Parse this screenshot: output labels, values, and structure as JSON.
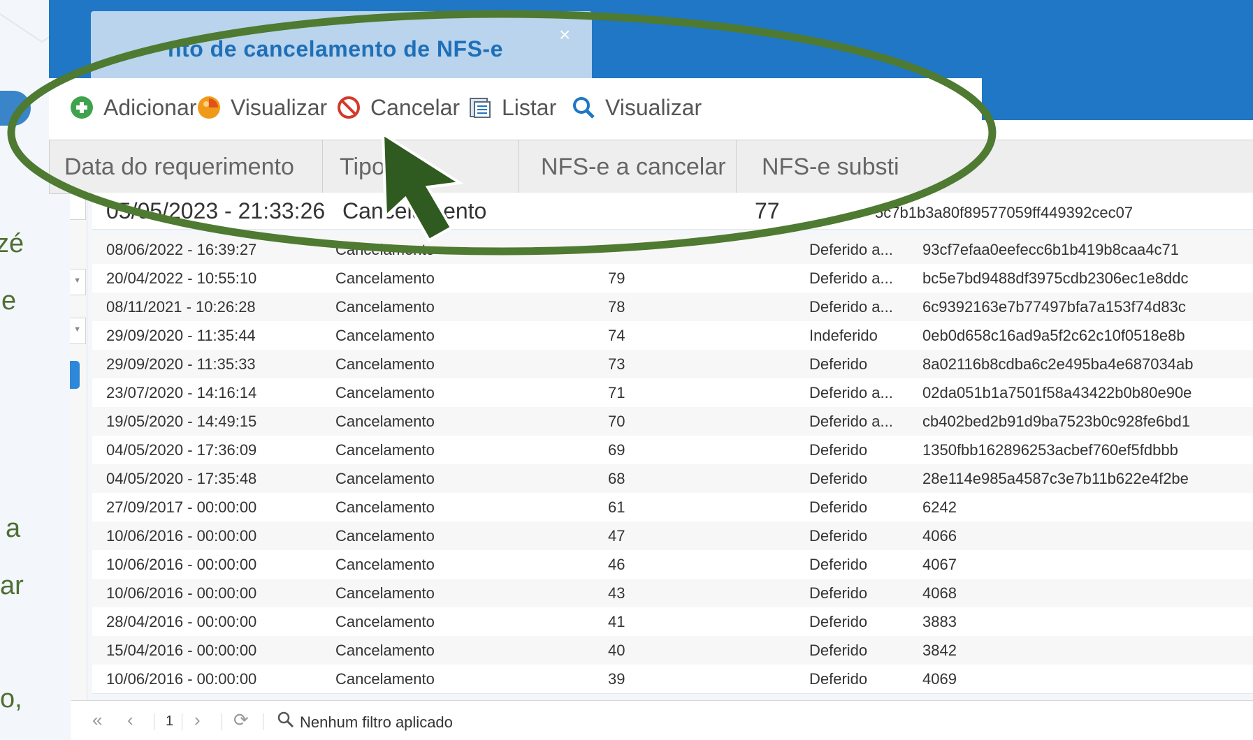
{
  "window": {
    "tab_title": "nto de cancelamento de NFS-e",
    "tab_close": "×"
  },
  "left_text_fragments": [
    "zé",
    "e",
    "a",
    "ar",
    "o,"
  ],
  "toolbar": [
    {
      "label": "Adicionar",
      "icon": "plus-circle-icon"
    },
    {
      "label": "Visualizar",
      "icon": "orange-view-icon"
    },
    {
      "label": "Cancelar",
      "icon": "cancel-icon"
    },
    {
      "label": "Listar",
      "icon": "list-icon"
    },
    {
      "label": "Visualizar",
      "icon": "search-icon"
    }
  ],
  "columns": [
    "Data do requerimento",
    "Tipo",
    "NFS-e a cancelar",
    "",
    "NFS-e substi"
  ],
  "rows": [
    {
      "date": "05/05/2023 - 21:33:26",
      "tipo": "Cancelamento",
      "nfse": "77",
      "situacao": "",
      "hash": "5c7b1b3a80f89577059ff449392cec07"
    },
    {
      "date": "08/06/2022 - 16:39:27",
      "tipo": "Cancelamento",
      "nfse": "",
      "situacao": "Deferido a...",
      "hash": "93cf7efaa0eefecc6b1b419b8caa4c71"
    },
    {
      "date": "20/04/2022 - 10:55:10",
      "tipo": "Cancelamento",
      "nfse": "79",
      "situacao": "Deferido a...",
      "hash": "bc5e7bd9488df3975cdb2306ec1e8ddc"
    },
    {
      "date": "08/11/2021 - 10:26:28",
      "tipo": "Cancelamento",
      "nfse": "78",
      "situacao": "Deferido a...",
      "hash": "6c9392163e7b77497bfa7a153f74d83c"
    },
    {
      "date": "29/09/2020 - 11:35:44",
      "tipo": "Cancelamento",
      "nfse": "74",
      "situacao": "Indeferido",
      "hash": "0eb0d658c16ad9a5f2c62c10f0518e8b"
    },
    {
      "date": "29/09/2020 - 11:35:33",
      "tipo": "Cancelamento",
      "nfse": "73",
      "situacao": "Deferido",
      "hash": "8a02116b8cdba6c2e495ba4e687034ab"
    },
    {
      "date": "23/07/2020 - 14:16:14",
      "tipo": "Cancelamento",
      "nfse": "71",
      "situacao": "Deferido a...",
      "hash": "02da051b1a7501f58a43422b0b80e90e"
    },
    {
      "date": "19/05/2020 - 14:49:15",
      "tipo": "Cancelamento",
      "nfse": "70",
      "situacao": "Deferido a...",
      "hash": "cb402bed2b91d9ba7523b0c928fe6bd1"
    },
    {
      "date": "04/05/2020 - 17:36:09",
      "tipo": "Cancelamento",
      "nfse": "69",
      "situacao": "Deferido",
      "hash": "1350fbb162896253acbef760ef5fdbbb"
    },
    {
      "date": "04/05/2020 - 17:35:48",
      "tipo": "Cancelamento",
      "nfse": "68",
      "situacao": "Deferido",
      "hash": "28e114e985a4587c3e7b11b622e4f2be"
    },
    {
      "date": "27/09/2017 - 00:00:00",
      "tipo": "Cancelamento",
      "nfse": "61",
      "situacao": "Deferido",
      "hash": "6242"
    },
    {
      "date": "10/06/2016 - 00:00:00",
      "tipo": "Cancelamento",
      "nfse": "47",
      "situacao": "Deferido",
      "hash": "4066"
    },
    {
      "date": "10/06/2016 - 00:00:00",
      "tipo": "Cancelamento",
      "nfse": "46",
      "situacao": "Deferido",
      "hash": "4067"
    },
    {
      "date": "10/06/2016 - 00:00:00",
      "tipo": "Cancelamento",
      "nfse": "43",
      "situacao": "Deferido",
      "hash": "4068"
    },
    {
      "date": "28/04/2016 - 00:00:00",
      "tipo": "Cancelamento",
      "nfse": "41",
      "situacao": "Deferido",
      "hash": "3883"
    },
    {
      "date": "15/04/2016 - 00:00:00",
      "tipo": "Cancelamento",
      "nfse": "40",
      "situacao": "Deferido",
      "hash": "3842"
    },
    {
      "date": "10/06/2016 - 00:00:00",
      "tipo": "Cancelamento",
      "nfse": "39",
      "situacao": "Deferido",
      "hash": "4069"
    }
  ],
  "pager": {
    "first": "«",
    "prev": "‹",
    "page": "1",
    "next": "›",
    "refresh": "⟳",
    "status": "Nenhum filtro aplicado"
  },
  "colors": {
    "accent": "#1f77c6",
    "highlight_ring": "#4e7a31",
    "cursor": "#2f5a20"
  }
}
